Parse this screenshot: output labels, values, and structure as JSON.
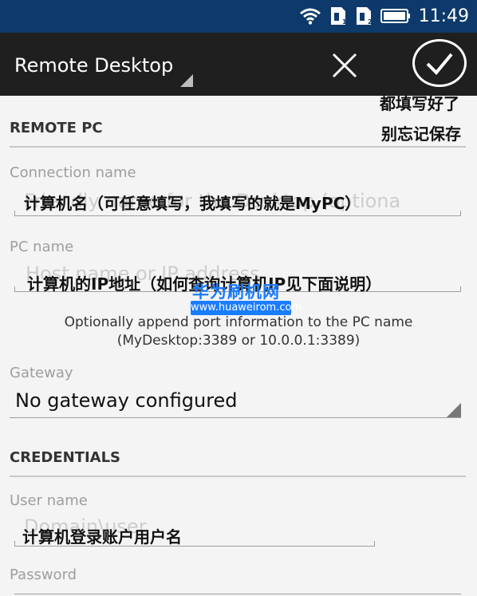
{
  "status_bar": {
    "time": "11:49",
    "icons": [
      "wifi-icon",
      "sim-1-icon",
      "sim-2-icon",
      "battery-icon"
    ]
  },
  "action_bar": {
    "title": "Remote Desktop",
    "close_icon": "close-icon",
    "save_icon": "checkmark-icon"
  },
  "annotations": {
    "save_note_line1": "都填写好了",
    "save_note_line2": "别忘记保存"
  },
  "remote_pc": {
    "section_title": "REMOTE PC",
    "connection_name": {
      "label": "Connection name",
      "placeholder": "Friendly name for the Desktop (optiona",
      "annotation": "计算机名（可任意填写，我填写的就是MyPC）"
    },
    "pc_name": {
      "label": "PC name",
      "placeholder": "Host name or IP address",
      "annotation": "计算机的IP地址（如何查询计算机IP见下面说明）"
    },
    "pc_name_hint_line1": "Optionally append port information to the PC name",
    "pc_name_hint_line2": "(MyDesktop:3389 or 10.0.0.1:3389)",
    "gateway": {
      "label": "Gateway",
      "value": "No gateway configured"
    }
  },
  "credentials": {
    "section_title": "CREDENTIALS",
    "user_name": {
      "label": "User name",
      "placeholder": "Domain\\user",
      "annotation": "计算机登录账户用户名"
    },
    "password": {
      "label": "Password"
    }
  },
  "watermark": {
    "title": "华为刷机网",
    "url": "www.huaweirom.com"
  }
}
